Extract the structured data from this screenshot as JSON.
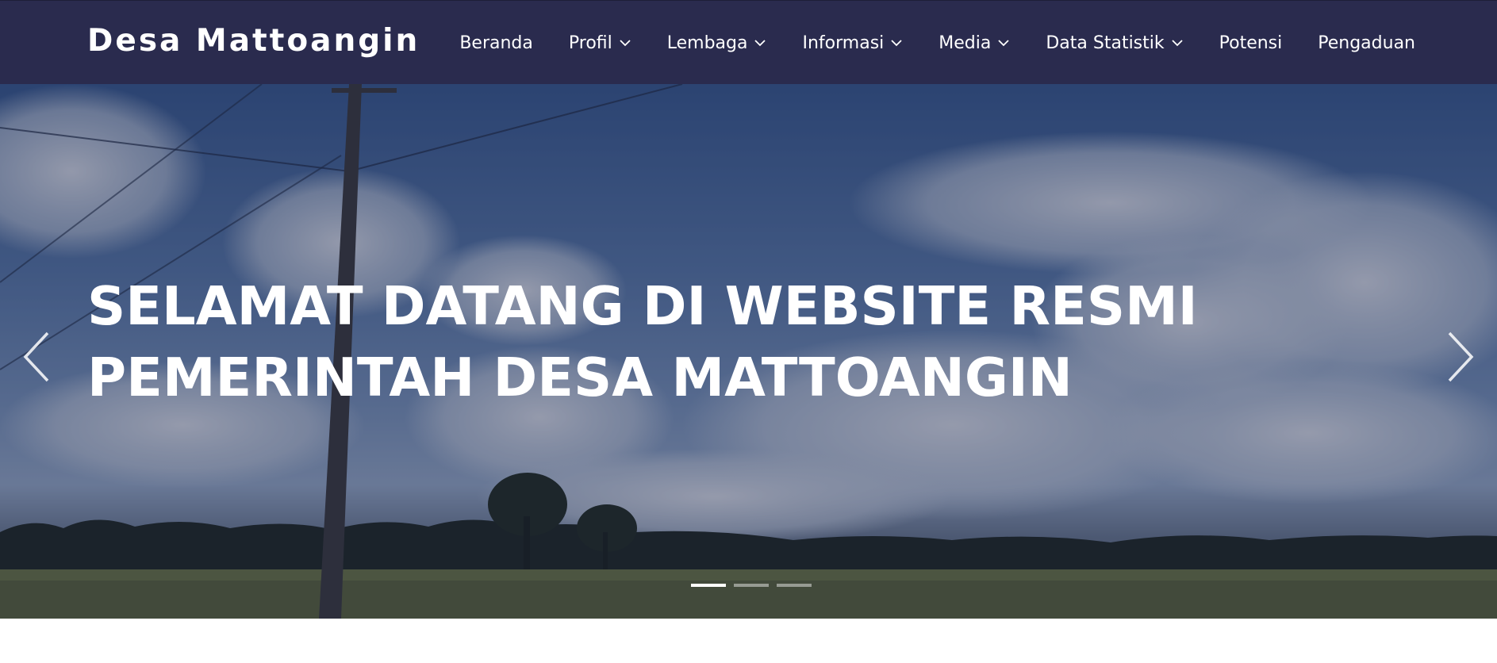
{
  "brand": {
    "name": "Desa Mattoangin"
  },
  "nav": {
    "items": [
      {
        "label": "Beranda",
        "dropdown": false
      },
      {
        "label": "Profil",
        "dropdown": true
      },
      {
        "label": "Lembaga",
        "dropdown": true
      },
      {
        "label": "Informasi",
        "dropdown": true
      },
      {
        "label": "Media",
        "dropdown": true
      },
      {
        "label": "Data Statistik",
        "dropdown": true
      },
      {
        "label": "Potensi",
        "dropdown": false
      },
      {
        "label": "Pengaduan",
        "dropdown": false
      }
    ]
  },
  "hero": {
    "title_line1": "SELAMAT DATANG DI WEBSITE RESMI",
    "title_line2": "PEMERINTAH DESA MATTOANGIN",
    "prev_icon": "chevron-left-icon",
    "next_icon": "chevron-right-icon",
    "slide_count": 3,
    "active_slide": 1
  },
  "colors": {
    "navbar_bg": "#2a2b4e",
    "text": "#ffffff"
  }
}
